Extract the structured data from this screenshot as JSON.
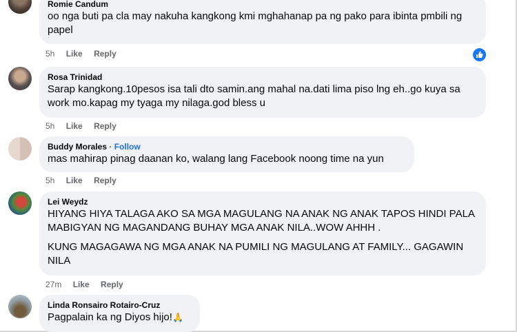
{
  "comments": [
    {
      "name": "Romie Candum",
      "text": "oo nga buti pa cla may nakuha kangkong kmi mghahanap pa ng pako para ibinta pmbili ng papel",
      "time": "5h",
      "like": "Like",
      "reply": "Reply",
      "reaction": "like-reaction-icon"
    },
    {
      "name": "Rosa Trinidad",
      "text": "Sarap kangkong.10pesos isa tali dto samin.ang mahal na.dati lima piso lng eh..go kuya sa work mo.kapag my tyaga my nilaga.god bless u",
      "time": "5h",
      "like": "Like",
      "reply": "Reply"
    },
    {
      "name": "Buddy Morales",
      "separator": "·",
      "follow": "Follow",
      "text": "mas mahirap pinag daanan ko, walang lang Facebook noong time na yun",
      "time": "5h",
      "like": "Like",
      "reply": "Reply"
    },
    {
      "name": "Lei Weydz",
      "paragraphs": [
        "HIYANG HIYA TALAGA AKO SA MGA MAGULANG NA ANAK NG ANAK TAPOS HINDI PALA MABIGYAN NG MAGANDANG BUHAY MGA ANAK NILA..WOW AHHH .",
        "KUNG MAGAGAWA NG MGA ANAK NA PUMILI NG MAGULANG AT FAMILY... GAGAWIN NILA"
      ],
      "time": "27m",
      "like": "Like",
      "reply": "Reply"
    },
    {
      "name": "Linda Ronsairo Rotairo-Cruz",
      "text": "Pagpalain ka ng Diyos hijo!",
      "emoji": "🙏"
    }
  ],
  "colors": {
    "bubble": "#f0f2f5",
    "follow": "#216fdb",
    "meta": "#65676b",
    "reaction": "#1877f2"
  }
}
